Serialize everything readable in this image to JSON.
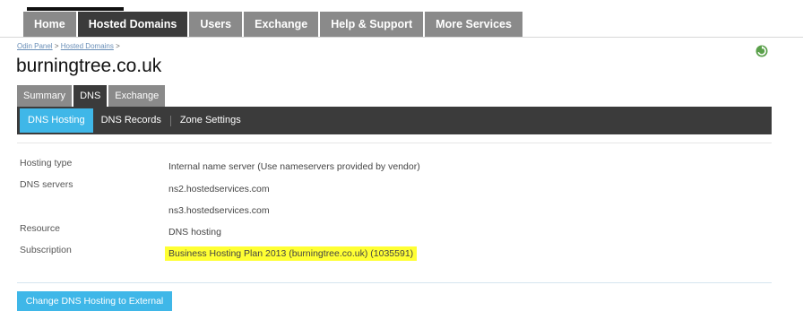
{
  "top_nav": {
    "items": [
      {
        "label": "Home"
      },
      {
        "label": "Hosted Domains",
        "active": true
      },
      {
        "label": "Users"
      },
      {
        "label": "Exchange"
      },
      {
        "label": "Help & Support"
      },
      {
        "label": "More Services"
      }
    ]
  },
  "breadcrumb": {
    "items": [
      "Odin Panel",
      "Hosted Domains"
    ],
    "separator": ">"
  },
  "page": {
    "title": "burningtree.co.uk"
  },
  "tabs": {
    "items": [
      {
        "label": "Summary"
      },
      {
        "label": "DNS",
        "active": true
      },
      {
        "label": "Exchange"
      }
    ]
  },
  "subnav": {
    "items": [
      {
        "label": "DNS Hosting",
        "active": true
      },
      {
        "label": "DNS Records"
      },
      {
        "label": "Zone Settings"
      }
    ]
  },
  "details": {
    "hosting_type": {
      "label": "Hosting type",
      "value": "Internal name server (Use nameservers provided by vendor)"
    },
    "dns_servers": {
      "label": "DNS servers",
      "values": [
        "ns2.hostedservices.com",
        "ns3.hostedservices.com"
      ]
    },
    "resource": {
      "label": "Resource",
      "value": "DNS hosting"
    },
    "subscription": {
      "label": "Subscription",
      "value": "Business Hosting Plan 2013 (burningtree.co.uk) (1035591)"
    }
  },
  "actions": {
    "change_dns_label": "Change DNS Hosting to External"
  },
  "icons": {
    "refresh": "refresh-icon"
  },
  "colors": {
    "nav_active": "#3b3b3b",
    "nav_inactive": "#8a8a8a",
    "accent": "#3fb7e8",
    "highlight": "#ffff33"
  }
}
